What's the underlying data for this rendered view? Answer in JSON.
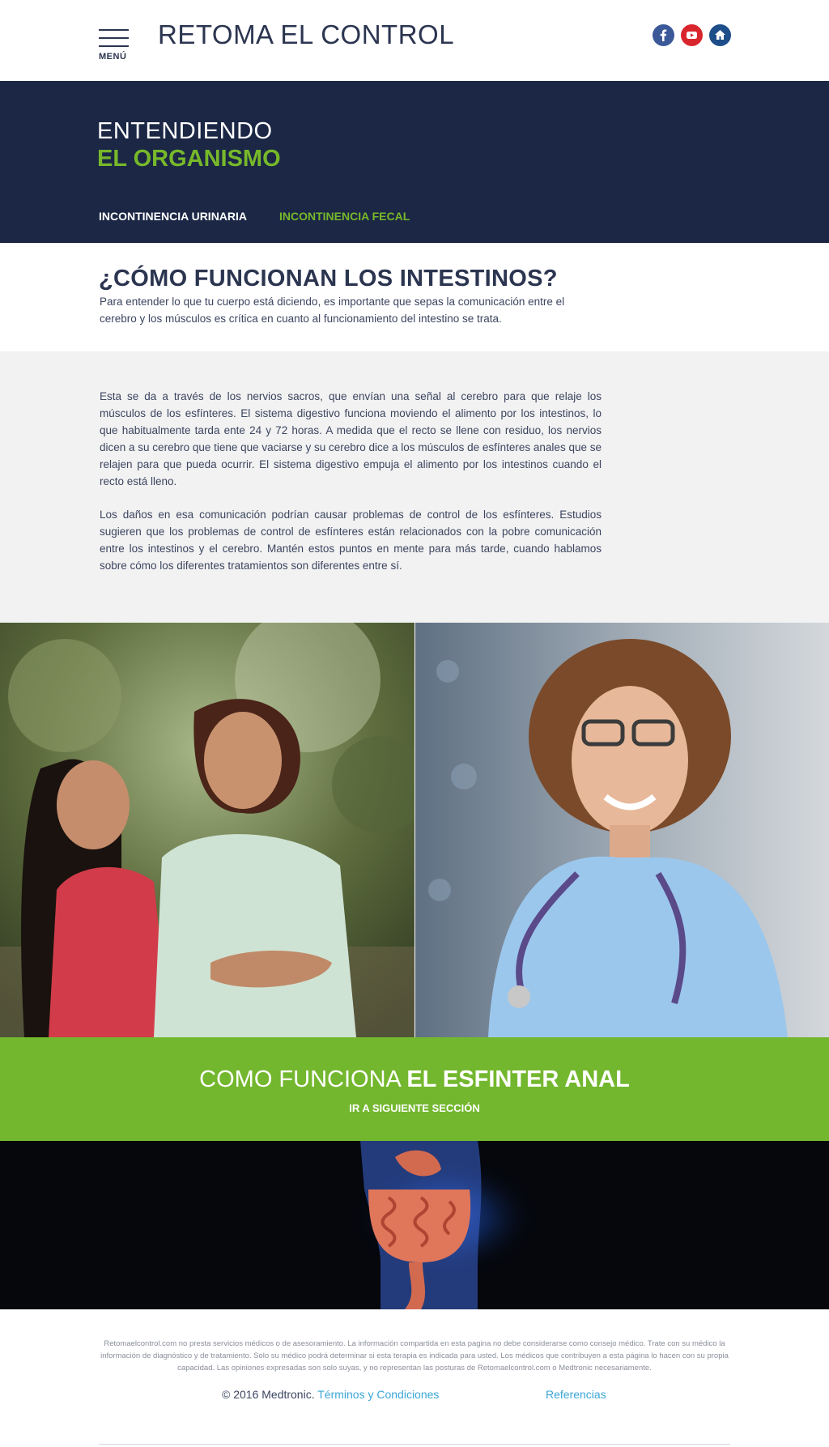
{
  "header": {
    "menu_label": "MENÚ",
    "site_title": "RETOMA EL CONTROL",
    "social_icons": [
      "facebook-icon",
      "youtube-icon",
      "home-icon"
    ]
  },
  "hero": {
    "line1": "ENTENDIENDO",
    "line2": "EL ORGANISMO",
    "tabs": [
      {
        "label": "INCONTINENCIA URINARIA",
        "active": false
      },
      {
        "label": "INCONTINENCIA FECAL",
        "active": true
      }
    ]
  },
  "intro": {
    "title": "¿CÓMO FUNCIONAN LOS INTESTINOS?",
    "text": "Para entender lo que tu cuerpo está diciendo, es importante que sepas la comunicación entre el cerebro y los músculos es crítica en cuanto al funcionamiento del intestino se trata."
  },
  "body": {
    "paragraph1": "Esta se da a través de los nervios sacros, que envían una señal al cerebro para que relaje los músculos de los esfínteres. El sistema digestivo funciona moviendo el alimento por los intestinos, lo que habitualmente tarda ente 24 y 72 horas. A medida que el recto se llene con residuo, los nervios dicen a su cerebro que tiene que vaciarse y su cerebro dice a los músculos de esfínteres anales que se relajen para que pueda ocurrir.  El sistema digestivo empuja el alimento por los intestinos cuando el recto está lleno.",
    "paragraph2": "Los daños en esa comunicación podrían causar problemas de control de los esfínteres. Estudios sugieren que los problemas de control de esfínteres están relacionados con la pobre comunicación entre los intestinos y el cerebro. Mantén estos puntos en mente para más tarde, cuando hablamos sobre cómo los diferentes tratamientos son diferentes entre sí."
  },
  "cta": {
    "title_light": "COMO FUNCIONA ",
    "title_bold": "EL ESFINTER ANAL",
    "subtitle": "IR A SIGUIENTE SECCIÓN"
  },
  "footer": {
    "disclaimer": "Retomaelcontrol.com no presta servicios médicos o de asesoramiento. La información compartida en esta pagina no debe considerarse como consejo médico. Trate con su médico la información de diagnóstico y de tratamiento. Solo su médico podrá determinar si esta terapia es indicada para usted. Los médicos que contribuyen a esta página lo hacen con su propia capacidad. Las opiniones expresadas son solo suyas, y no representan las posturas de Retomaelcontrol.com o Medtronic necesariamente.",
    "copyright": "© 2016 Medtronic. ",
    "terms": "Términos y Condiciones",
    "references": "Referencias"
  },
  "colors": {
    "navy": "#1b2745",
    "green": "#73b72e",
    "link": "#3aa6d6"
  }
}
